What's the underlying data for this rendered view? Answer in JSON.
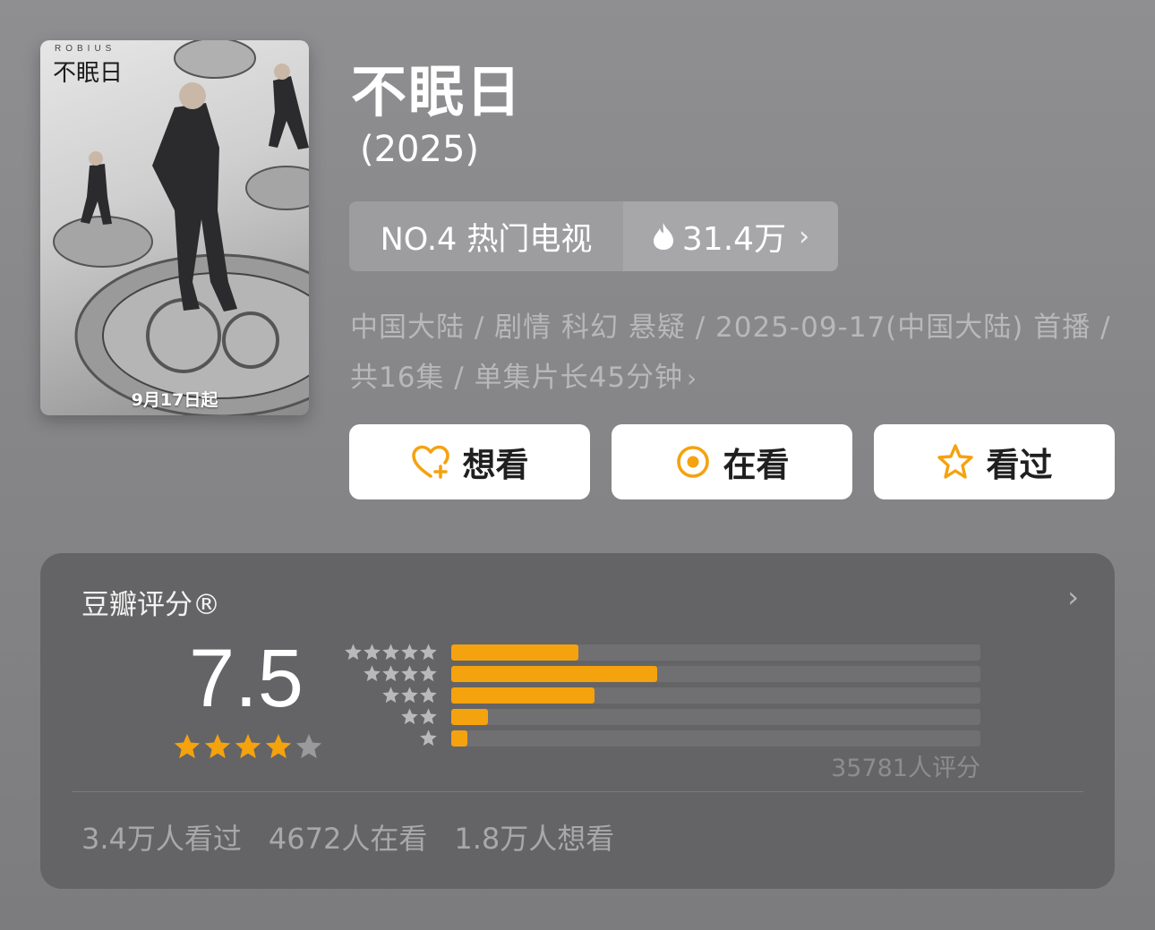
{
  "poster": {
    "brand": "ROBIUS",
    "title": "不眠日",
    "date_label": "9月17日起"
  },
  "header": {
    "title": "不眠日",
    "year": "(2025)"
  },
  "rank": {
    "label": "NO.4 热门电视",
    "heat": "31.4万"
  },
  "meta": {
    "line1": "中国大陆 / 剧情 科幻 悬疑 / 2025-09-17(中国大陆) 首播 /",
    "line2": "共16集 / 单集片长45分钟"
  },
  "actions": {
    "want": "想看",
    "watching": "在看",
    "watched": "看过"
  },
  "rating": {
    "title": "豆瓣评分®",
    "score": "7.5",
    "stars": 3.75,
    "distribution": [
      0.24,
      0.39,
      0.27,
      0.07,
      0.03
    ],
    "count": "35781人评分",
    "stats": [
      "3.4万人看过",
      "4672人在看",
      "1.8万人想看"
    ]
  },
  "colors": {
    "accent": "#f5a20f",
    "card": "#646466",
    "background": "#8a8a8c"
  }
}
